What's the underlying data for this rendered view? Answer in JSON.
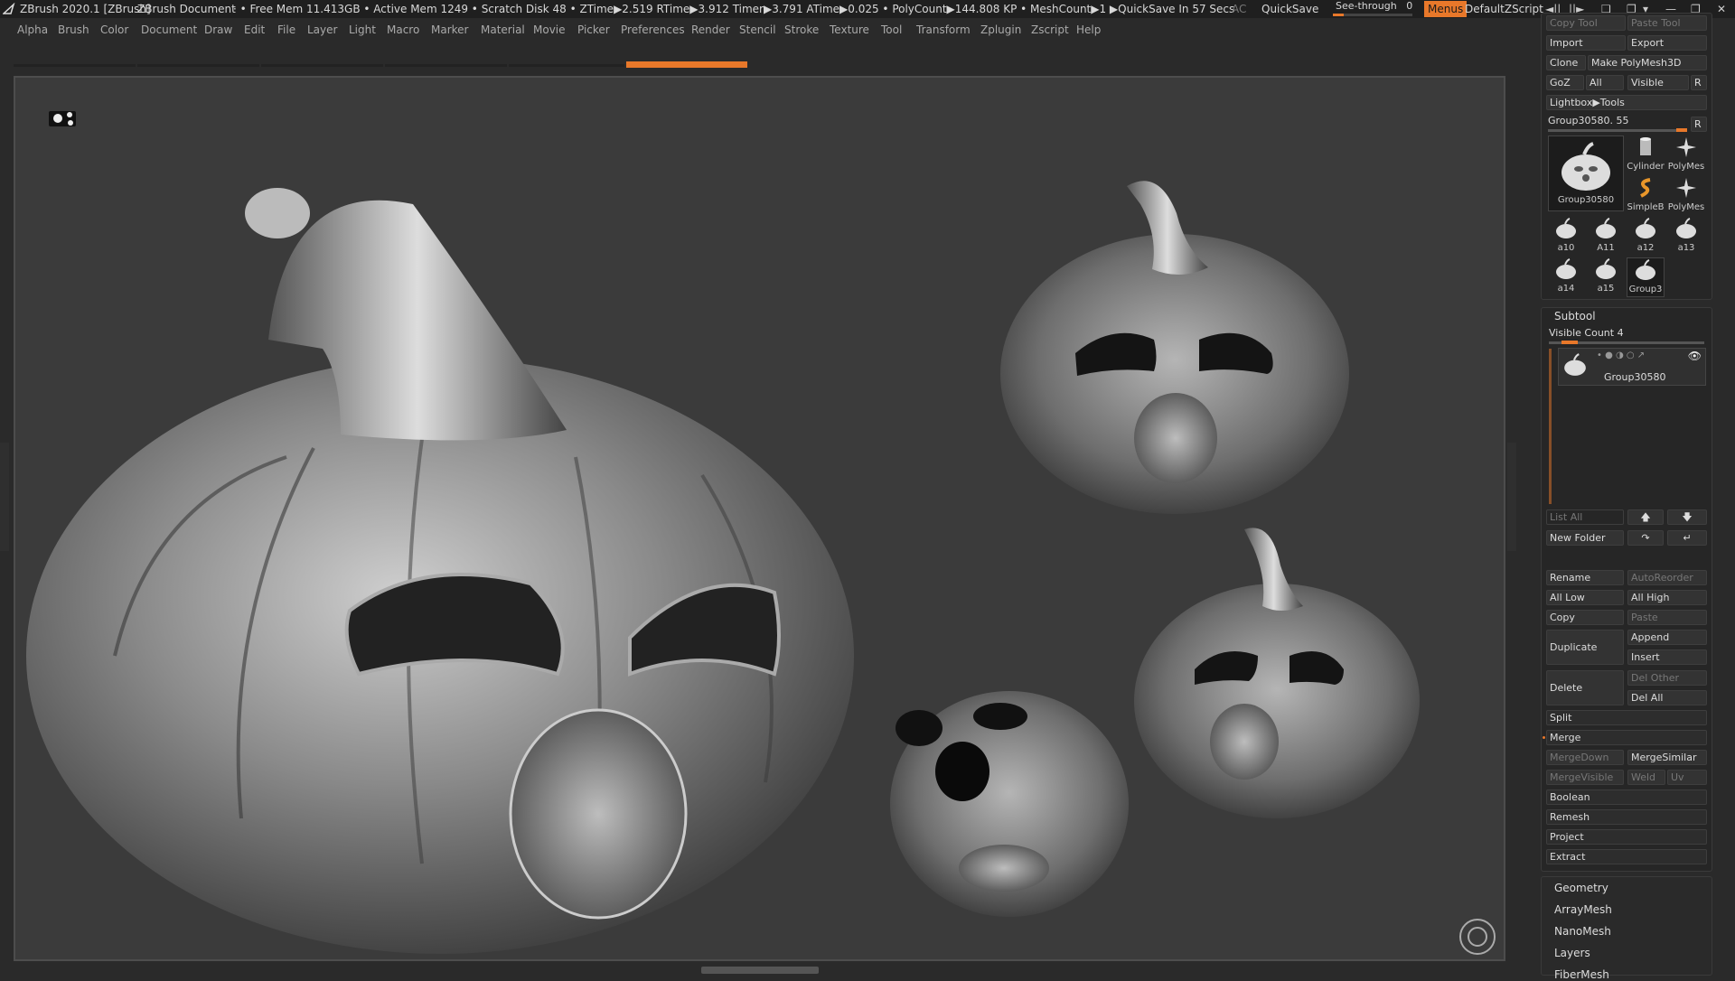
{
  "title_bar": {
    "app": "ZBrush 2020.1 [ZBrush]",
    "document": "ZBrush Document",
    "stats": "· • Free Mem 11.413GB • Active Mem 1249 • Scratch Disk 48 • ZTime▶2.519 RTime▶3.912 Timer▶3.791 ATime▶0.025 • PolyCount▶144.808 KP • MeshCount▶1 ▶QuickSave In 57 Secs",
    "ac": "AC",
    "quicksave": "QuickSave",
    "see_through_label": "See-through",
    "see_through_value": "0",
    "see_through_level": 0,
    "menus": "Menus",
    "default_script": "DefaultZScript",
    "accent_color": "#e8782a"
  },
  "menu": [
    "Alpha",
    "Brush",
    "Color",
    "Document",
    "Draw",
    "Edit",
    "File",
    "Layer",
    "Light",
    "Macro",
    "Marker",
    "Material",
    "Movie",
    "Picker",
    "Preferences",
    "Render",
    "Stencil",
    "Stroke",
    "Texture",
    "Tool",
    "Transform",
    "Zplugin",
    "Zscript",
    "Help"
  ],
  "tool_panel": {
    "copy_tool": "Copy Tool",
    "paste_tool": "Paste Tool",
    "import": "Import",
    "export": "Export",
    "clone": "Clone",
    "make_polymesh": "Make PolyMesh3D",
    "goz": "GoZ",
    "all": "All",
    "visible": "Visible",
    "r": "R",
    "lightbox_tools": "Lightbox▶Tools",
    "current_tool_label": "Group30580. 55",
    "current_tool_r": "R",
    "main_thumb_label": "Group30580",
    "thumbs": [
      {
        "label": "Cylinder",
        "icon": "cylinder-icon"
      },
      {
        "label": "PolyMes",
        "icon": "star-icon"
      },
      {
        "label": "SimpleB",
        "icon": "snake-icon"
      },
      {
        "label": "PolyMes",
        "icon": "star-icon"
      },
      {
        "label": "a10",
        "icon": "pumpkin-icon"
      },
      {
        "label": "A11",
        "icon": "pumpkin-icon"
      },
      {
        "label": "a12",
        "icon": "pumpkin-icon"
      },
      {
        "label": "a13",
        "icon": "pumpkin-icon"
      },
      {
        "label": "a14",
        "icon": "pumpkin-icon"
      },
      {
        "label": "a15",
        "icon": "pumpkin-icon"
      },
      {
        "label": "Group3",
        "icon": "pumpkin-icon"
      }
    ]
  },
  "subtool": {
    "header": "Subtool",
    "visible_count": "Visible Count 4",
    "item_name": "Group30580",
    "list_all": "List All",
    "new_folder": "New Folder",
    "rename": "Rename",
    "auto_reorder": "AutoReorder",
    "all_low": "All Low",
    "all_high": "All High",
    "copy": "Copy",
    "paste": "Paste",
    "duplicate": "Duplicate",
    "append": "Append",
    "insert": "Insert",
    "delete": "Delete",
    "del_other": "Del Other",
    "del_all": "Del All",
    "split": "Split",
    "merge": "Merge",
    "merge_down": "MergeDown",
    "merge_similar": "MergeSimilar",
    "merge_visible": "MergeVisible",
    "weld": "Weld",
    "uv": "Uv",
    "boolean": "Boolean",
    "remesh": "Remesh",
    "project": "Project",
    "extract": "Extract"
  },
  "nav": [
    "Geometry",
    "ArrayMesh",
    "NanoMesh",
    "Layers",
    "FiberMesh"
  ]
}
